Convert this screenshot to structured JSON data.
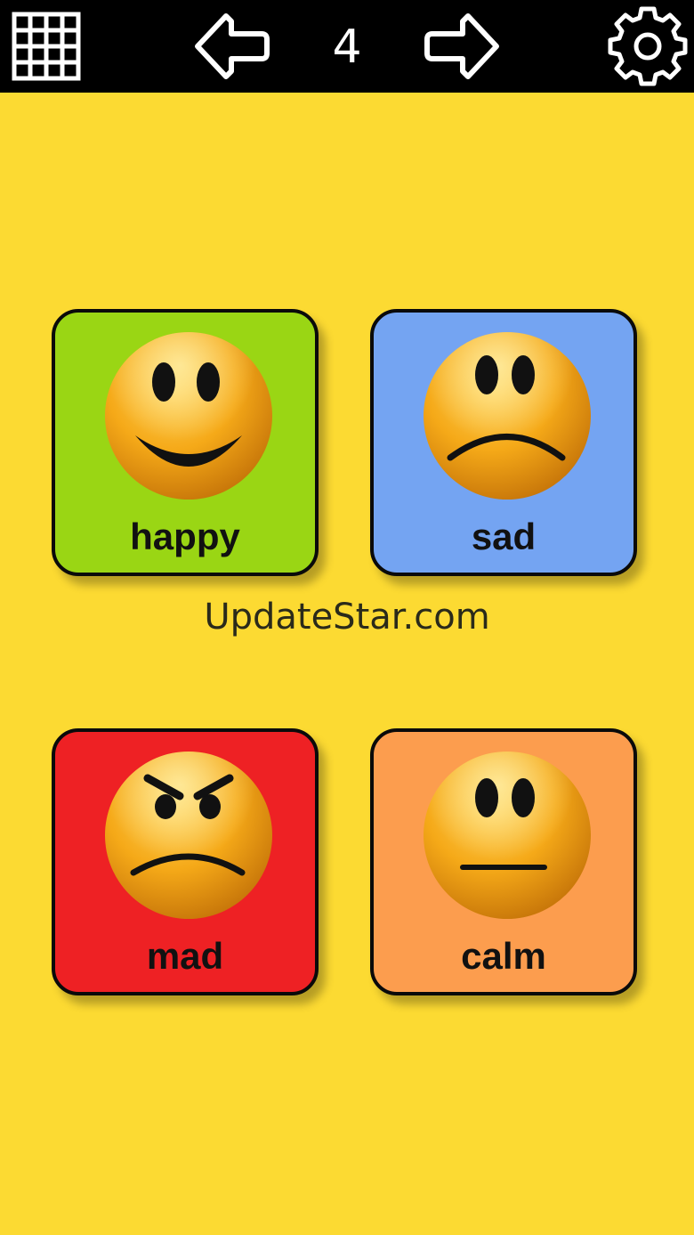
{
  "toolbar": {
    "page_number": "4",
    "icons": {
      "grid": "grid-icon",
      "prev": "arrow-left-icon",
      "next": "arrow-right-icon",
      "settings": "gear-icon"
    }
  },
  "cards": [
    {
      "label": "happy",
      "bg": "#9AD614",
      "face": "smile-face-icon"
    },
    {
      "label": "sad",
      "bg": "#74A4F2",
      "face": "frown-face-icon"
    },
    {
      "label": "mad",
      "bg": "#EE2124",
      "face": "angry-face-icon"
    },
    {
      "label": "calm",
      "bg": "#FC9D4E",
      "face": "neutral-face-icon"
    }
  ],
  "watermark": "UpdateStar.com",
  "colors": {
    "background": "#FCDA32",
    "toolbar": "#000000",
    "face": "#F4A81C"
  }
}
